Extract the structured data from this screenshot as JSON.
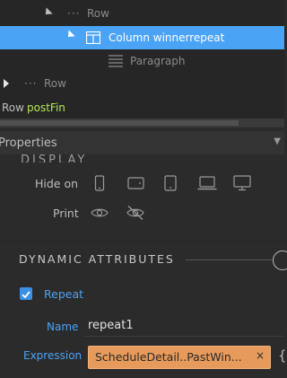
{
  "tree": {
    "items": [
      {
        "label": "Row"
      },
      {
        "label": "Column winnerrepeat"
      },
      {
        "label": "Paragraph"
      },
      {
        "label": "Row"
      }
    ],
    "breadcrumb": {
      "parent": "Row",
      "current": "postFin"
    }
  },
  "properties": {
    "header": "Properties",
    "display_section": "DISPLAY",
    "hide_on_label": "Hide on",
    "print_label": "Print",
    "dynamic_section": "DYNAMIC ATTRIBUTES",
    "repeat_label": "Repeat",
    "repeat_checked": true,
    "name_label": "Name",
    "name_value": "repeat1",
    "expression_label": "Expression",
    "expression_value": "ScheduleDetail..PastWin...",
    "remove_glyph": "×",
    "binding_glyph": "{"
  },
  "icons": [
    "tree-expand-icon",
    "tree-collapsed-icon",
    "column-icon",
    "paragraph-icon",
    "mobile-icon",
    "tablet-landscape-icon",
    "tablet-portrait-icon",
    "laptop-icon",
    "desktop-icon",
    "eye-icon",
    "eye-slash-icon",
    "check-icon",
    "add-icon"
  ],
  "colors": {
    "selection": "#4aa3f5",
    "accent_link": "#4aa3f5",
    "chip_bg": "#e69a5b",
    "breadcrumb_current": "#b5e853"
  }
}
